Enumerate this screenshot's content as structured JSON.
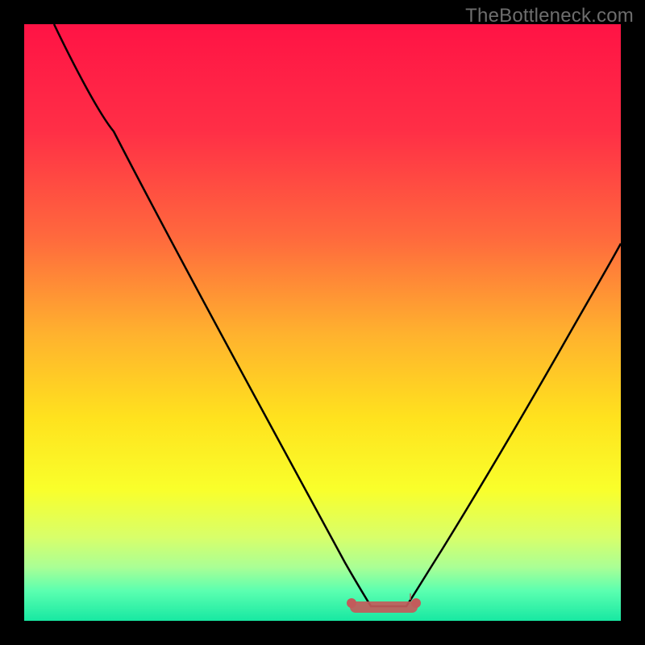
{
  "watermark": "TheBottleneck.com",
  "colors": {
    "frame": "#000000",
    "watermark": "#6d6d6d",
    "curve": "#000000",
    "plateau_fill": "#c25b5b",
    "gradient_stops": [
      {
        "offset": "0%",
        "color": "#ff1345"
      },
      {
        "offset": "18%",
        "color": "#ff2f46"
      },
      {
        "offset": "36%",
        "color": "#ff6a3d"
      },
      {
        "offset": "52%",
        "color": "#ffb22e"
      },
      {
        "offset": "66%",
        "color": "#ffe21e"
      },
      {
        "offset": "78%",
        "color": "#f9ff2b"
      },
      {
        "offset": "86%",
        "color": "#d8ff6a"
      },
      {
        "offset": "91%",
        "color": "#aaff95"
      },
      {
        "offset": "95%",
        "color": "#5bffb0"
      },
      {
        "offset": "100%",
        "color": "#17e8a2"
      }
    ]
  },
  "chart_data": {
    "type": "line",
    "title": "",
    "xlabel": "",
    "ylabel": "",
    "xlim": [
      0,
      100
    ],
    "ylim": [
      0,
      100
    ],
    "description": "V-shaped bottleneck curve: high values toward both edges, minimum (flat zero plateau) around x≈55–65, highlighted by a desaturated red band.",
    "series": [
      {
        "name": "bottleneck-curve",
        "x": [
          5,
          10,
          15,
          20,
          25,
          30,
          35,
          40,
          45,
          50,
          53,
          56,
          58,
          60,
          62,
          64,
          66,
          70,
          75,
          80,
          85,
          90,
          95,
          100
        ],
        "y": [
          100,
          91,
          82,
          73,
          63,
          54,
          44,
          34,
          24,
          14,
          7,
          2,
          0,
          0,
          0,
          1,
          3,
          8,
          15,
          23,
          32,
          41,
          50,
          59
        ]
      }
    ],
    "plateau": {
      "x_start": 55,
      "x_end": 66,
      "y": 0
    }
  }
}
